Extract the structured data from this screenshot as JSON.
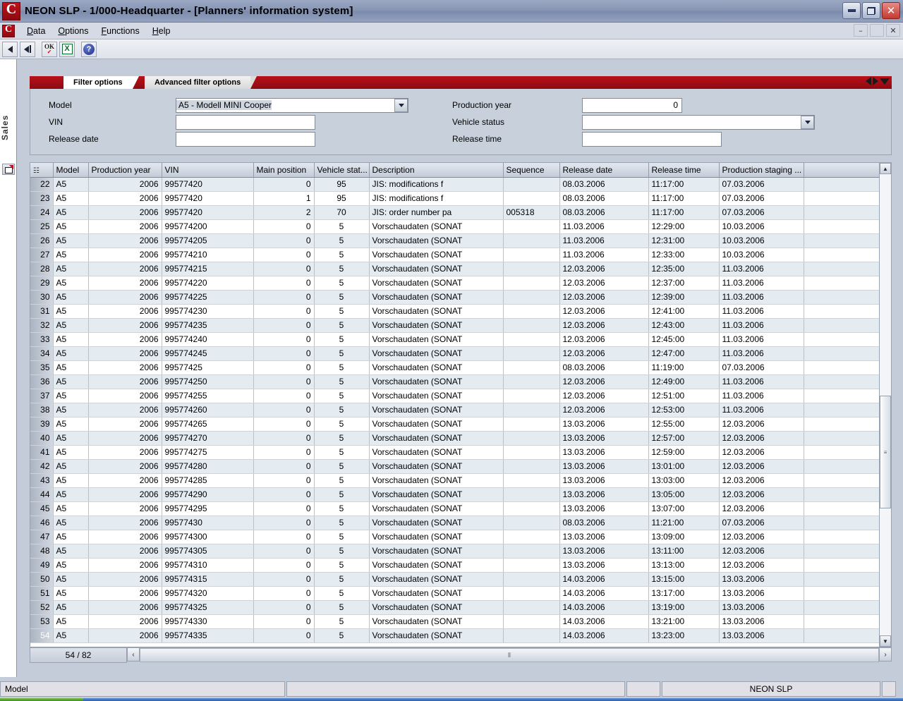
{
  "window": {
    "title": "NEON SLP - 1/000-Headquarter - [Planners' information system]",
    "logo_letter": "C",
    "minimize_label": "",
    "restore_label": "",
    "close_label": "✕",
    "mdi_minimize": "–",
    "mdi_restore": "❐",
    "mdi_close": "✕"
  },
  "menu": {
    "items": [
      "Data",
      "Options",
      "Functions",
      "Help"
    ]
  },
  "toolbar": {
    "buttons": [
      {
        "name": "back-button",
        "glyph": "◀"
      },
      {
        "name": "first-record-button",
        "glyph": "◀|"
      },
      {
        "name": "ok-apply-button",
        "glyph": "OK"
      },
      {
        "name": "excel-export-button",
        "glyph": "X"
      },
      {
        "name": "help-button",
        "glyph": "?"
      }
    ]
  },
  "sidebar": {
    "tab_label": "Sales",
    "icon": "window-red-corner-icon"
  },
  "tabs": [
    {
      "label": "Filter options",
      "selected": true
    },
    {
      "label": "Advanced filter options",
      "selected": false
    }
  ],
  "filter": {
    "left": [
      {
        "label": "Model",
        "value": "A5 - Modell MINI Cooper",
        "type": "combo",
        "selected_text": true
      },
      {
        "label": "VIN",
        "value": "",
        "type": "text"
      },
      {
        "label": "Release date",
        "value": "",
        "type": "text"
      }
    ],
    "right": [
      {
        "label": "Production year",
        "value": "0",
        "type": "number"
      },
      {
        "label": "Vehicle status",
        "value": "",
        "type": "combo"
      },
      {
        "label": "Release time",
        "value": "",
        "type": "text"
      }
    ]
  },
  "grid": {
    "filter_glyph": "☷",
    "columns": [
      "Model",
      "Production year",
      "VIN",
      "Main position",
      "Vehicle stat...",
      "Description",
      "Sequence",
      "Release date",
      "Release time",
      "Production staging ...",
      ""
    ],
    "current_row_number": "54",
    "rows": [
      {
        "n": "22",
        "model": "A5",
        "year": "2006",
        "vin": "99577420",
        "main": "0",
        "status": "95",
        "desc": "JIS: modifications f",
        "seq": "",
        "rdate": "08.03.2006",
        "rtime": "11:17:00",
        "stage": "07.03.2006",
        "alt": true
      },
      {
        "n": "23",
        "model": "A5",
        "year": "2006",
        "vin": "99577420",
        "main": "1",
        "status": "95",
        "desc": "JIS: modifications f",
        "seq": "",
        "rdate": "08.03.2006",
        "rtime": "11:17:00",
        "stage": "07.03.2006",
        "alt": false
      },
      {
        "n": "24",
        "model": "A5",
        "year": "2006",
        "vin": "99577420",
        "main": "2",
        "status": "70",
        "desc": "JIS: order number pa",
        "seq": "005318",
        "rdate": "08.03.2006",
        "rtime": "11:17:00",
        "stage": "07.03.2006",
        "alt": true
      },
      {
        "n": "25",
        "model": "A5",
        "year": "2006",
        "vin": "995774200",
        "main": "0",
        "status": "5",
        "desc": "Vorschaudaten (SONAT",
        "seq": "",
        "rdate": "11.03.2006",
        "rtime": "12:29:00",
        "stage": "10.03.2006",
        "alt": false
      },
      {
        "n": "26",
        "model": "A5",
        "year": "2006",
        "vin": "995774205",
        "main": "0",
        "status": "5",
        "desc": "Vorschaudaten (SONAT",
        "seq": "",
        "rdate": "11.03.2006",
        "rtime": "12:31:00",
        "stage": "10.03.2006",
        "alt": true
      },
      {
        "n": "27",
        "model": "A5",
        "year": "2006",
        "vin": "995774210",
        "main": "0",
        "status": "5",
        "desc": "Vorschaudaten (SONAT",
        "seq": "",
        "rdate": "11.03.2006",
        "rtime": "12:33:00",
        "stage": "10.03.2006",
        "alt": false
      },
      {
        "n": "28",
        "model": "A5",
        "year": "2006",
        "vin": "995774215",
        "main": "0",
        "status": "5",
        "desc": "Vorschaudaten (SONAT",
        "seq": "",
        "rdate": "12.03.2006",
        "rtime": "12:35:00",
        "stage": "11.03.2006",
        "alt": true
      },
      {
        "n": "29",
        "model": "A5",
        "year": "2006",
        "vin": "995774220",
        "main": "0",
        "status": "5",
        "desc": "Vorschaudaten (SONAT",
        "seq": "",
        "rdate": "12.03.2006",
        "rtime": "12:37:00",
        "stage": "11.03.2006",
        "alt": false
      },
      {
        "n": "30",
        "model": "A5",
        "year": "2006",
        "vin": "995774225",
        "main": "0",
        "status": "5",
        "desc": "Vorschaudaten (SONAT",
        "seq": "",
        "rdate": "12.03.2006",
        "rtime": "12:39:00",
        "stage": "11.03.2006",
        "alt": true
      },
      {
        "n": "31",
        "model": "A5",
        "year": "2006",
        "vin": "995774230",
        "main": "0",
        "status": "5",
        "desc": "Vorschaudaten (SONAT",
        "seq": "",
        "rdate": "12.03.2006",
        "rtime": "12:41:00",
        "stage": "11.03.2006",
        "alt": false
      },
      {
        "n": "32",
        "model": "A5",
        "year": "2006",
        "vin": "995774235",
        "main": "0",
        "status": "5",
        "desc": "Vorschaudaten (SONAT",
        "seq": "",
        "rdate": "12.03.2006",
        "rtime": "12:43:00",
        "stage": "11.03.2006",
        "alt": true
      },
      {
        "n": "33",
        "model": "A5",
        "year": "2006",
        "vin": "995774240",
        "main": "0",
        "status": "5",
        "desc": "Vorschaudaten (SONAT",
        "seq": "",
        "rdate": "12.03.2006",
        "rtime": "12:45:00",
        "stage": "11.03.2006",
        "alt": false
      },
      {
        "n": "34",
        "model": "A5",
        "year": "2006",
        "vin": "995774245",
        "main": "0",
        "status": "5",
        "desc": "Vorschaudaten (SONAT",
        "seq": "",
        "rdate": "12.03.2006",
        "rtime": "12:47:00",
        "stage": "11.03.2006",
        "alt": true
      },
      {
        "n": "35",
        "model": "A5",
        "year": "2006",
        "vin": "99577425",
        "main": "0",
        "status": "5",
        "desc": "Vorschaudaten (SONAT",
        "seq": "",
        "rdate": "08.03.2006",
        "rtime": "11:19:00",
        "stage": "07.03.2006",
        "alt": false
      },
      {
        "n": "36",
        "model": "A5",
        "year": "2006",
        "vin": "995774250",
        "main": "0",
        "status": "5",
        "desc": "Vorschaudaten (SONAT",
        "seq": "",
        "rdate": "12.03.2006",
        "rtime": "12:49:00",
        "stage": "11.03.2006",
        "alt": true
      },
      {
        "n": "37",
        "model": "A5",
        "year": "2006",
        "vin": "995774255",
        "main": "0",
        "status": "5",
        "desc": "Vorschaudaten (SONAT",
        "seq": "",
        "rdate": "12.03.2006",
        "rtime": "12:51:00",
        "stage": "11.03.2006",
        "alt": false
      },
      {
        "n": "38",
        "model": "A5",
        "year": "2006",
        "vin": "995774260",
        "main": "0",
        "status": "5",
        "desc": "Vorschaudaten (SONAT",
        "seq": "",
        "rdate": "12.03.2006",
        "rtime": "12:53:00",
        "stage": "11.03.2006",
        "alt": true
      },
      {
        "n": "39",
        "model": "A5",
        "year": "2006",
        "vin": "995774265",
        "main": "0",
        "status": "5",
        "desc": "Vorschaudaten (SONAT",
        "seq": "",
        "rdate": "13.03.2006",
        "rtime": "12:55:00",
        "stage": "12.03.2006",
        "alt": false
      },
      {
        "n": "40",
        "model": "A5",
        "year": "2006",
        "vin": "995774270",
        "main": "0",
        "status": "5",
        "desc": "Vorschaudaten (SONAT",
        "seq": "",
        "rdate": "13.03.2006",
        "rtime": "12:57:00",
        "stage": "12.03.2006",
        "alt": true
      },
      {
        "n": "41",
        "model": "A5",
        "year": "2006",
        "vin": "995774275",
        "main": "0",
        "status": "5",
        "desc": "Vorschaudaten (SONAT",
        "seq": "",
        "rdate": "13.03.2006",
        "rtime": "12:59:00",
        "stage": "12.03.2006",
        "alt": false
      },
      {
        "n": "42",
        "model": "A5",
        "year": "2006",
        "vin": "995774280",
        "main": "0",
        "status": "5",
        "desc": "Vorschaudaten (SONAT",
        "seq": "",
        "rdate": "13.03.2006",
        "rtime": "13:01:00",
        "stage": "12.03.2006",
        "alt": true
      },
      {
        "n": "43",
        "model": "A5",
        "year": "2006",
        "vin": "995774285",
        "main": "0",
        "status": "5",
        "desc": "Vorschaudaten (SONAT",
        "seq": "",
        "rdate": "13.03.2006",
        "rtime": "13:03:00",
        "stage": "12.03.2006",
        "alt": false
      },
      {
        "n": "44",
        "model": "A5",
        "year": "2006",
        "vin": "995774290",
        "main": "0",
        "status": "5",
        "desc": "Vorschaudaten (SONAT",
        "seq": "",
        "rdate": "13.03.2006",
        "rtime": "13:05:00",
        "stage": "12.03.2006",
        "alt": true
      },
      {
        "n": "45",
        "model": "A5",
        "year": "2006",
        "vin": "995774295",
        "main": "0",
        "status": "5",
        "desc": "Vorschaudaten (SONAT",
        "seq": "",
        "rdate": "13.03.2006",
        "rtime": "13:07:00",
        "stage": "12.03.2006",
        "alt": false
      },
      {
        "n": "46",
        "model": "A5",
        "year": "2006",
        "vin": "99577430",
        "main": "0",
        "status": "5",
        "desc": "Vorschaudaten (SONAT",
        "seq": "",
        "rdate": "08.03.2006",
        "rtime": "11:21:00",
        "stage": "07.03.2006",
        "alt": true
      },
      {
        "n": "47",
        "model": "A5",
        "year": "2006",
        "vin": "995774300",
        "main": "0",
        "status": "5",
        "desc": "Vorschaudaten (SONAT",
        "seq": "",
        "rdate": "13.03.2006",
        "rtime": "13:09:00",
        "stage": "12.03.2006",
        "alt": false
      },
      {
        "n": "48",
        "model": "A5",
        "year": "2006",
        "vin": "995774305",
        "main": "0",
        "status": "5",
        "desc": "Vorschaudaten (SONAT",
        "seq": "",
        "rdate": "13.03.2006",
        "rtime": "13:11:00",
        "stage": "12.03.2006",
        "alt": true
      },
      {
        "n": "49",
        "model": "A5",
        "year": "2006",
        "vin": "995774310",
        "main": "0",
        "status": "5",
        "desc": "Vorschaudaten (SONAT",
        "seq": "",
        "rdate": "13.03.2006",
        "rtime": "13:13:00",
        "stage": "12.03.2006",
        "alt": false
      },
      {
        "n": "50",
        "model": "A5",
        "year": "2006",
        "vin": "995774315",
        "main": "0",
        "status": "5",
        "desc": "Vorschaudaten (SONAT",
        "seq": "",
        "rdate": "14.03.2006",
        "rtime": "13:15:00",
        "stage": "13.03.2006",
        "alt": true
      },
      {
        "n": "51",
        "model": "A5",
        "year": "2006",
        "vin": "995774320",
        "main": "0",
        "status": "5",
        "desc": "Vorschaudaten (SONAT",
        "seq": "",
        "rdate": "14.03.2006",
        "rtime": "13:17:00",
        "stage": "13.03.2006",
        "alt": false
      },
      {
        "n": "52",
        "model": "A5",
        "year": "2006",
        "vin": "995774325",
        "main": "0",
        "status": "5",
        "desc": "Vorschaudaten (SONAT",
        "seq": "",
        "rdate": "14.03.2006",
        "rtime": "13:19:00",
        "stage": "13.03.2006",
        "alt": true
      },
      {
        "n": "53",
        "model": "A5",
        "year": "2006",
        "vin": "995774330",
        "main": "0",
        "status": "5",
        "desc": "Vorschaudaten (SONAT",
        "seq": "",
        "rdate": "14.03.2006",
        "rtime": "13:21:00",
        "stage": "13.03.2006",
        "alt": false
      },
      {
        "n": "54",
        "model": "A5",
        "year": "2006",
        "vin": "995774335",
        "main": "0",
        "status": "5",
        "desc": "Vorschaudaten (SONAT",
        "seq": "",
        "rdate": "14.03.2006",
        "rtime": "13:23:00",
        "stage": "13.03.2006",
        "alt": true
      }
    ]
  },
  "footer": {
    "record_count": "54 / 82",
    "scroll_left": "‹",
    "scroll_right": "›",
    "hthumb_grip": "⦀"
  },
  "scrollbar": {
    "up": "▲",
    "down": "▼",
    "grip": "≡"
  },
  "statusbar": {
    "field": "Model",
    "middle": "",
    "small": "",
    "app": "NEON SLP",
    "end": ""
  },
  "colors": {
    "accent_red": "#b8111b",
    "current_row": "#e00000",
    "window_bg": "#c3ccd8",
    "row_alt": "#e4ebf1"
  }
}
